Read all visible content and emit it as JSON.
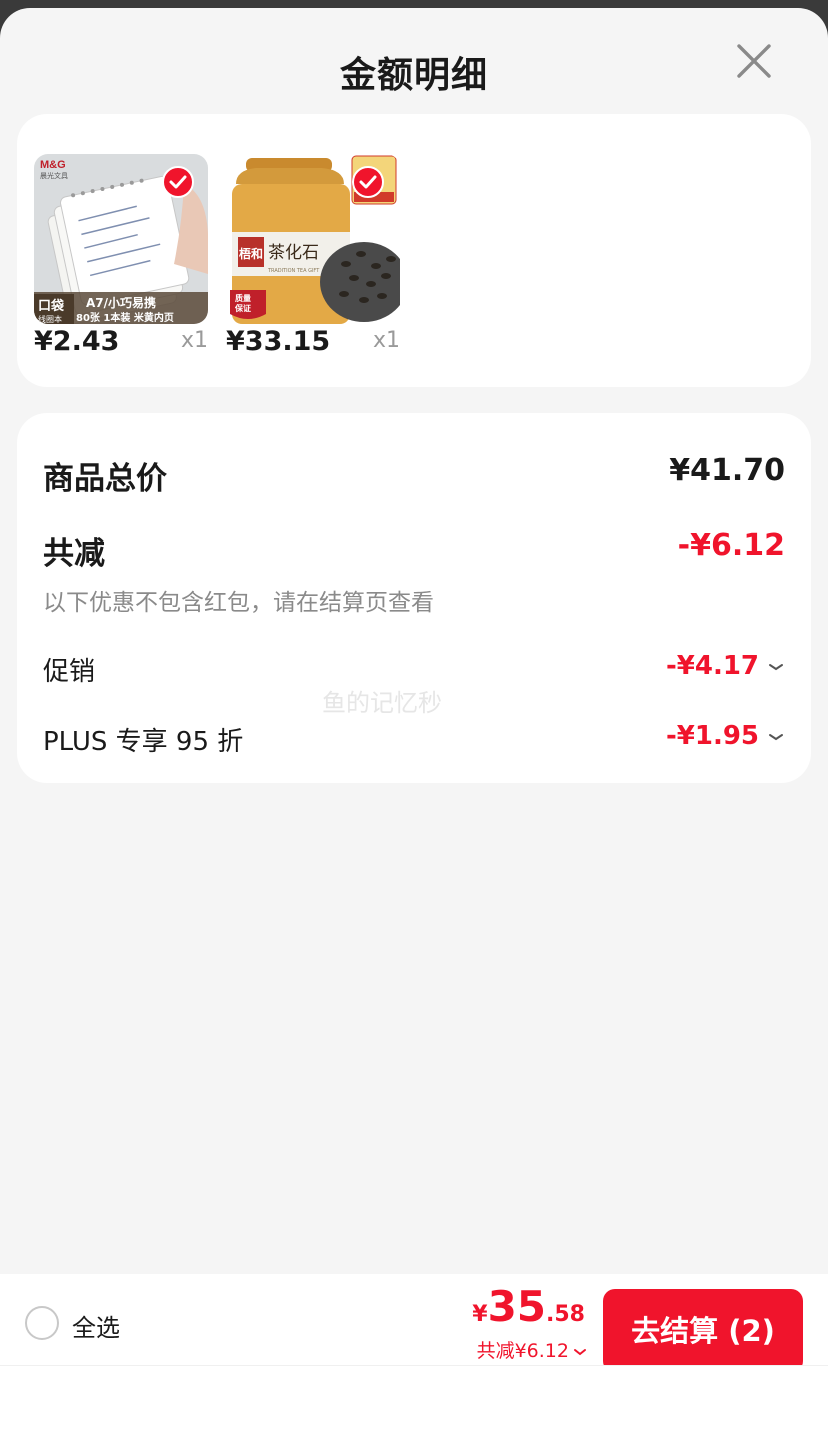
{
  "header": {
    "title": "金额明细"
  },
  "products": [
    {
      "price": "¥2.43",
      "qty": "x1",
      "selected": true,
      "thumb_text": {
        "brand": "M&G",
        "brand_sub": "晨光文具",
        "tag1": "口袋",
        "tag2": "线圈本",
        "line1": "A7/小巧易携",
        "line2": "80张 1本装 米黄内页"
      }
    },
    {
      "price": "¥33.15",
      "qty": "x1",
      "selected": true,
      "thumb_text": {
        "brand": "梧和",
        "name": "茶化石",
        "sub": "TRADITION TEA GIFT",
        "badge": "质量保证"
      }
    }
  ],
  "summary": {
    "total_label": "商品总价",
    "total_value": "¥41.70",
    "discount_label": "共减",
    "discount_value": "-¥6.12",
    "note": "以下优惠不包含红包，请在结算页查看",
    "items": [
      {
        "label": "促销",
        "value": "-¥4.17"
      },
      {
        "label": "PLUS 专享 95 折",
        "value": "-¥1.95"
      }
    ]
  },
  "watermark": "鱼的记忆秒",
  "bottom": {
    "select_all": "全选",
    "currency": "¥",
    "amount_int": "35",
    "amount_dec": ".58",
    "saved": "共减¥6.12",
    "checkout": "去结算 (2)"
  },
  "colors": {
    "accent": "#f0142c",
    "background": "#f5f5f5"
  }
}
